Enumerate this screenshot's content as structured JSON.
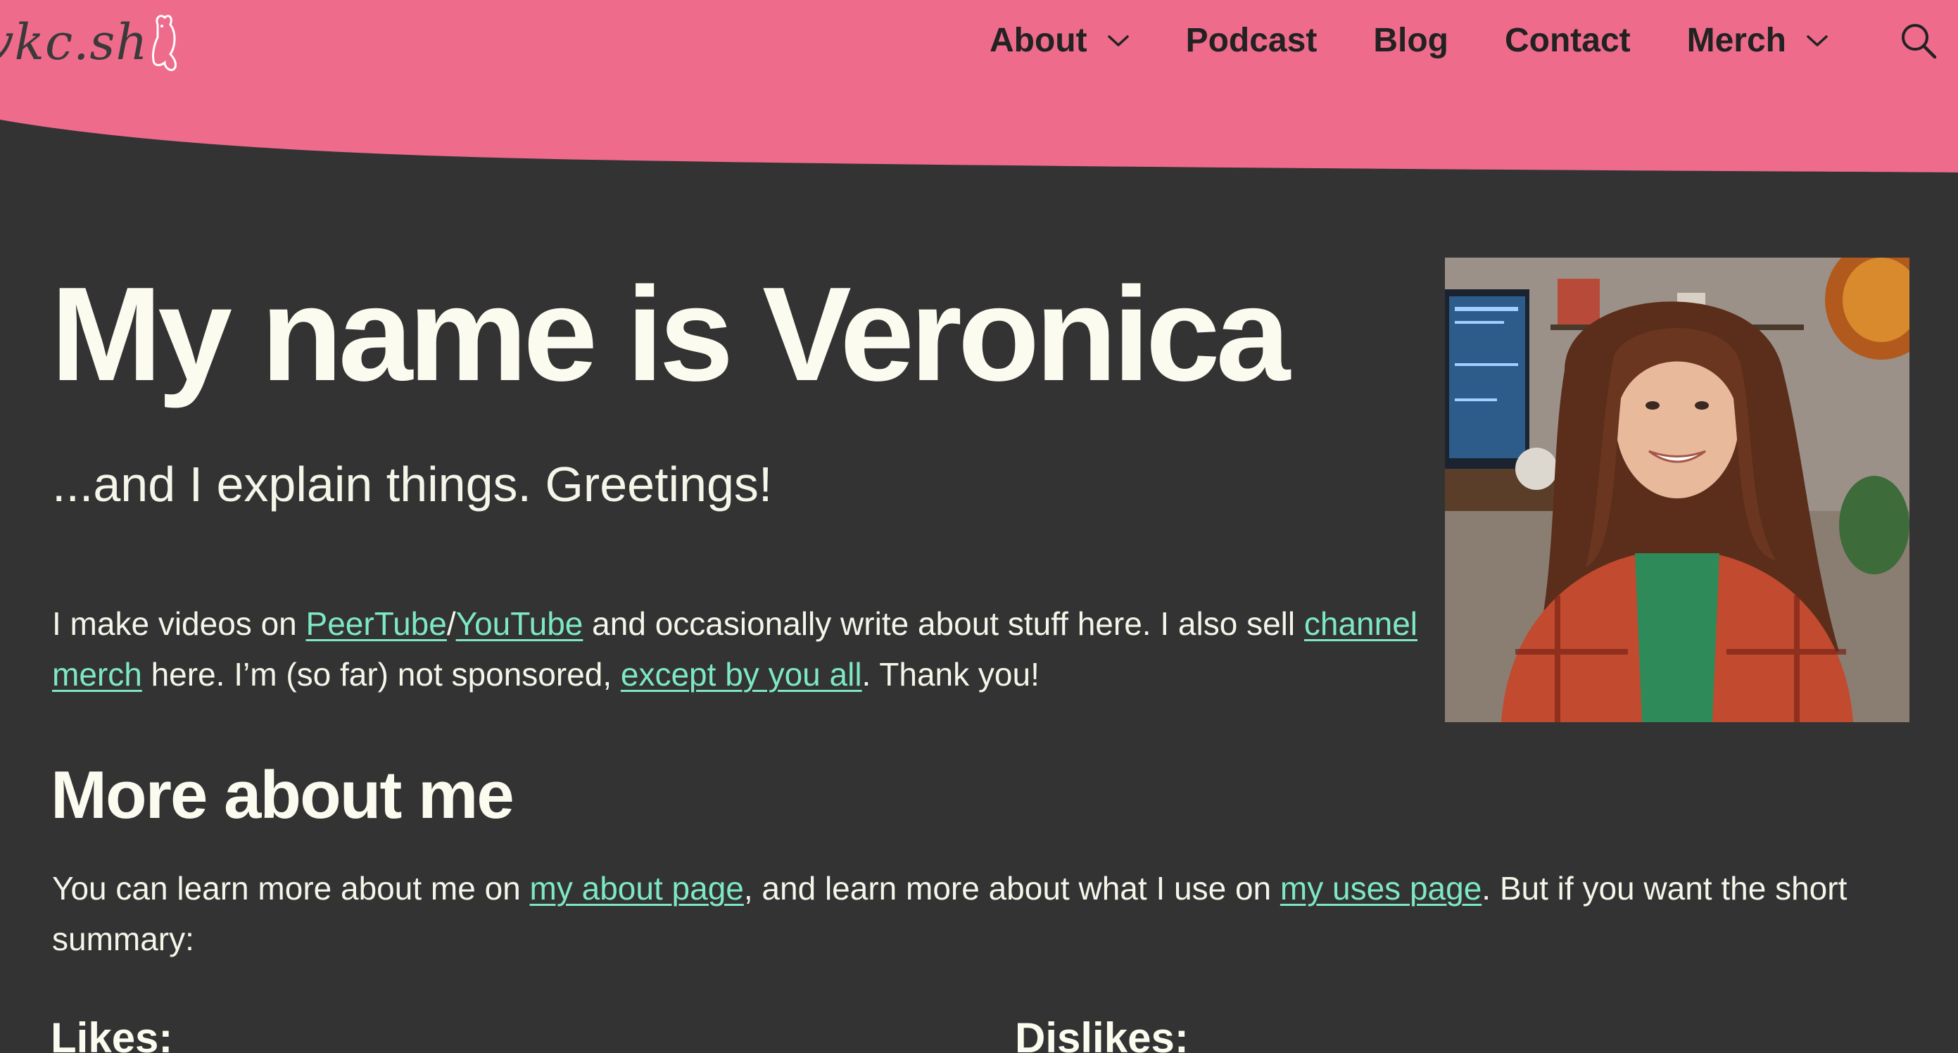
{
  "site": {
    "logo_text": "vkc.sh",
    "colors": {
      "header_pink": "#ee6b8b",
      "background": "#333333",
      "heading_text": "#fbfbf0",
      "link": "#7de8c4"
    }
  },
  "nav": {
    "about": "About",
    "podcast": "Podcast",
    "blog": "Blog",
    "contact": "Contact",
    "merch": "Merch",
    "search_icon": "search-icon",
    "dropdown_icon": "chevron-down-icon"
  },
  "hero": {
    "title": "My name is Veronica",
    "subtitle": "...and I explain things. Greetings!",
    "photo_alt": "Veronica smiling at her desk"
  },
  "intro": {
    "part1": "I make videos on ",
    "peertube": "PeerTube",
    "slash": "/",
    "youtube": "YouTube",
    "part2": " and occasionally write about stuff here. I also sell ",
    "merch_link": "channel merch",
    "part3": " here. I’m (so far) not sponsored, ",
    "support_link": "except by you all",
    "part4": ". Thank you!"
  },
  "more": {
    "title": "More about me",
    "part1": "You can learn more about me on ",
    "about_link": "my about page",
    "part2": ", and learn more about what I use on ",
    "uses_link": "my uses page",
    "part3": ". But if you want the short summary:"
  },
  "lists": {
    "likes_title": "Likes:",
    "dislikes_title": "Dislikes:"
  }
}
